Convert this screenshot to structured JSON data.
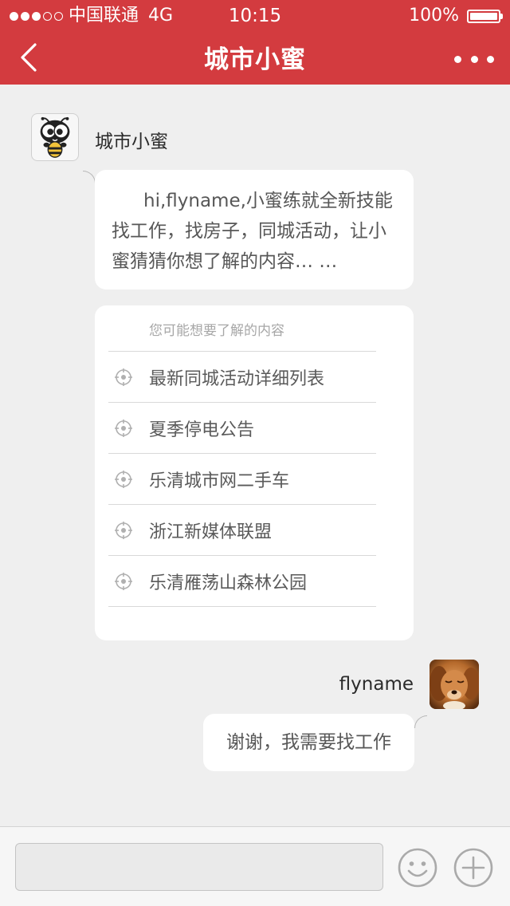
{
  "status_bar": {
    "carrier": "中国联通",
    "network": "4G",
    "time": "10:15",
    "battery_percent": "100%",
    "signal_strength": "3 of 5",
    "battery_level": 1.0
  },
  "nav": {
    "title": "城市小蜜",
    "back_icon": "chevron-left-icon",
    "more_icon": "more-dots-icon"
  },
  "chat": {
    "bot": {
      "name": "城市小蜜",
      "avatar_icon": "bee-mascot-icon",
      "message": "hi,flyname,小蜜练就全新技能找工作，找房子，同城活动，让小蜜猜猜你想了解的内容… …"
    },
    "suggestions": {
      "title": "您可能想要了解的内容",
      "item_icon": "target-icon",
      "items": [
        {
          "label": "最新同城活动详细列表"
        },
        {
          "label": "夏季停电公告"
        },
        {
          "label": "乐清城市网二手车"
        },
        {
          "label": "浙江新媒体联盟"
        },
        {
          "label": "乐清雁荡山森林公园"
        }
      ]
    },
    "user": {
      "name": "flyname",
      "avatar_icon": "dog-photo-avatar",
      "message": "谢谢，我需要找工作"
    }
  },
  "input_bar": {
    "value": "",
    "placeholder": "",
    "emoji_icon": "smiley-icon",
    "add_icon": "plus-circle-icon"
  },
  "colors": {
    "brand_red": "#d33b3f",
    "background": "#efefef",
    "bubble": "#ffffff",
    "muted_text": "#a7a7a7"
  }
}
